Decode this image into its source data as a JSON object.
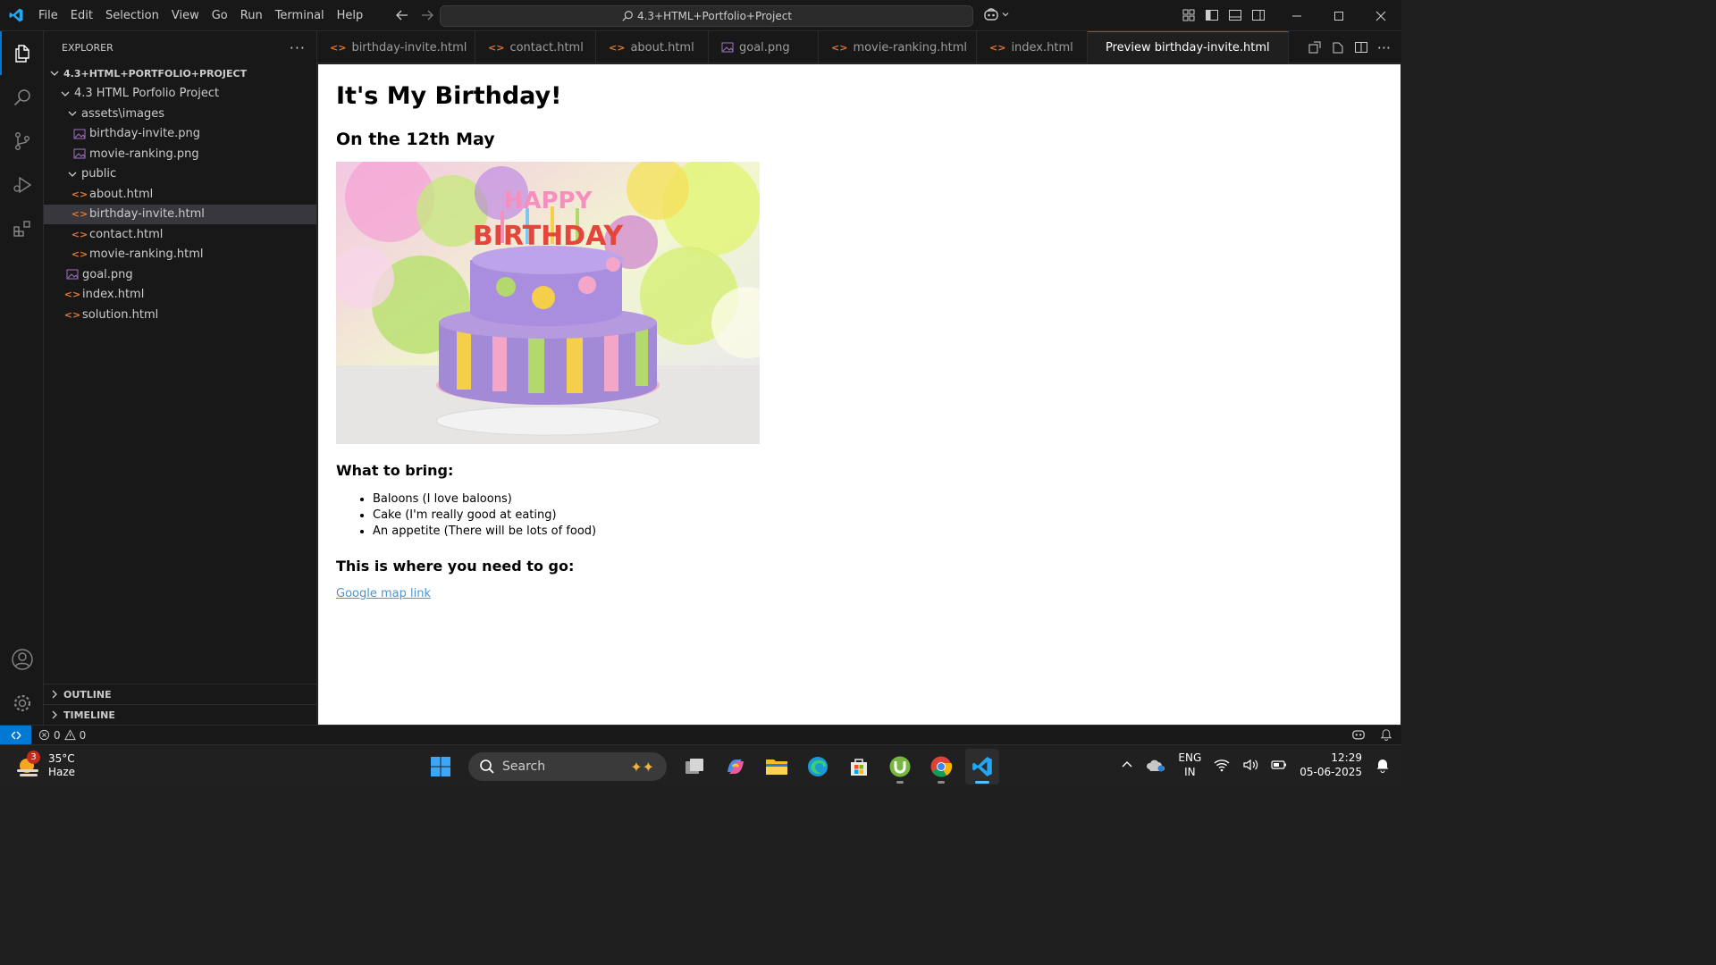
{
  "titlebar": {
    "menu": [
      "File",
      "Edit",
      "Selection",
      "View",
      "Go",
      "Run",
      "Terminal",
      "Help"
    ],
    "search_text": "4.3+HTML+Portfolio+Project"
  },
  "explorer": {
    "title": "EXPLORER",
    "root": "4.3+HTML+PORTFOLIO+PROJECT",
    "project_folder": "4.3 HTML Porfolio Project",
    "assets_folder": "assets\\images",
    "asset_files": [
      "birthday-invite.png",
      "movie-ranking.png"
    ],
    "public_folder": "public",
    "public_files": [
      "about.html",
      "birthday-invite.html",
      "contact.html",
      "movie-ranking.html"
    ],
    "root_files": [
      "goal.png",
      "index.html",
      "solution.html"
    ],
    "outline": "OUTLINE",
    "timeline": "TIMELINE"
  },
  "tabs": [
    "birthday-invite.html",
    "contact.html",
    "about.html",
    "goal.png",
    "movie-ranking.html",
    "index.html",
    "Preview birthday-invite.html"
  ],
  "preview": {
    "h1": "It's My Birthday!",
    "h2": "On the 12th May",
    "bring_heading": "What to bring:",
    "items": [
      "Baloons (I love baloons)",
      "Cake (I'm really good at eating)",
      "An appetite (There will be lots of food)"
    ],
    "go_heading": "This is where you need to go:",
    "link": "Google map link",
    "cake_text_1": "HAPPY",
    "cake_text_2": "BIRTHDAY"
  },
  "statusbar": {
    "errors": "0",
    "warnings": "0"
  },
  "taskbar": {
    "temp": "35°C",
    "weather": "Haze",
    "weather_badge": "3",
    "search_placeholder": "Search",
    "lang1": "ENG",
    "lang2": "IN",
    "time": "12:29",
    "date": "05-06-2025"
  },
  "colors": {
    "accent": "#0078d4",
    "link": "#4e94ce",
    "html_icon": "#e37933",
    "image_icon": "#a074c4"
  }
}
